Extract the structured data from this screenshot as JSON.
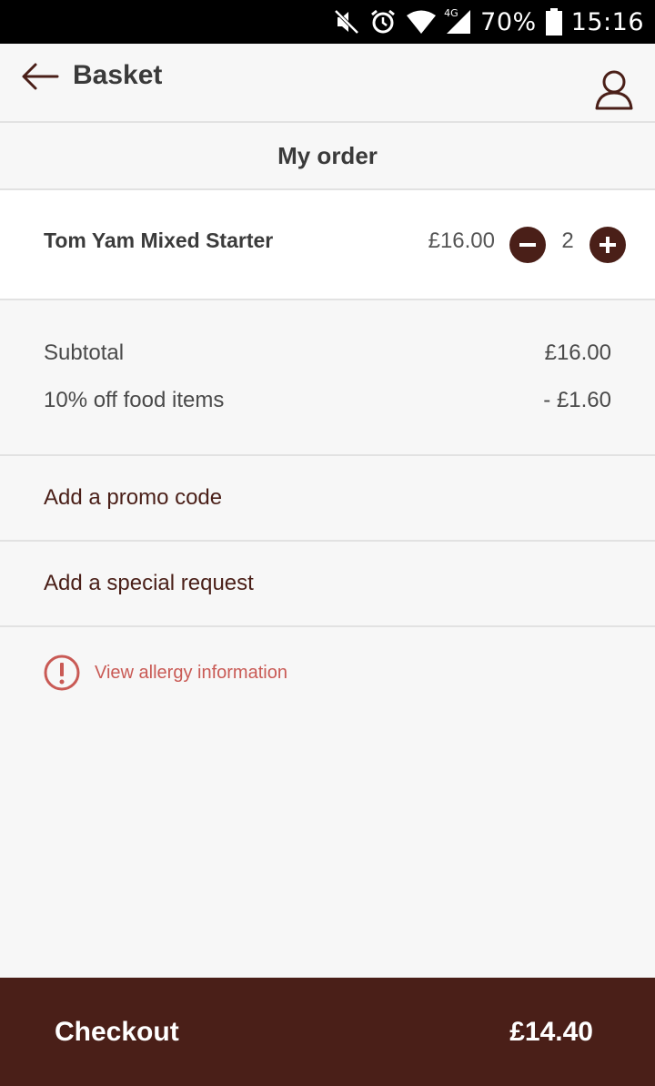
{
  "status_bar": {
    "battery": "70%",
    "time": "15:16",
    "network": "4G"
  },
  "header": {
    "title": "Basket"
  },
  "section": {
    "title": "My order"
  },
  "order_items": [
    {
      "name": "Tom Yam Mixed Starter",
      "price": "£16.00",
      "quantity": "2"
    }
  ],
  "totals": {
    "subtotal_label": "Subtotal",
    "subtotal_value": "£16.00",
    "discount_label": "10% off food items",
    "discount_value": "- £1.60"
  },
  "actions": {
    "promo_label": "Add a promo code",
    "request_label": "Add a special request"
  },
  "allergy": {
    "label": "View allergy information"
  },
  "checkout": {
    "label": "Checkout",
    "total": "£14.40"
  },
  "colors": {
    "brand": "#4a1f18",
    "warning": "#c95a55",
    "background": "#f7f7f7"
  }
}
